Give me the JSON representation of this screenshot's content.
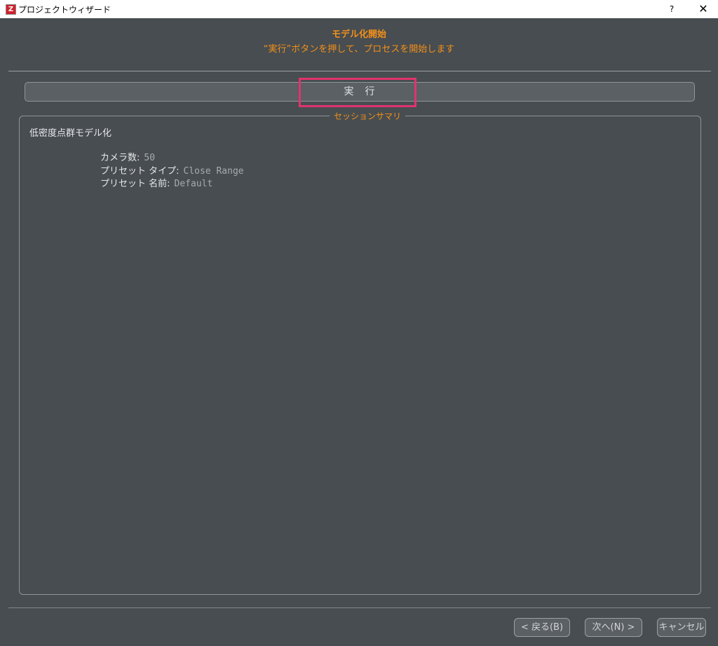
{
  "window": {
    "title": "プロジェクトウィザード",
    "app_icon_letter": "Z",
    "help_label": "?",
    "close_label": "✕"
  },
  "header": {
    "title": "モデル化開始",
    "subtitle": "“実行”ボタンを押して、プロセスを開始します"
  },
  "run_button": {
    "label": "実　行"
  },
  "summary": {
    "legend": "セッションサマリ",
    "heading": "低密度点群モデル化",
    "rows": [
      {
        "key": "カメラ数:",
        "value": "50"
      },
      {
        "key": "プリセット タイプ:",
        "value": "Close Range"
      },
      {
        "key": "プリセット 名前:",
        "value": "Default"
      }
    ]
  },
  "footer": {
    "back_label": "< 戻る(B)",
    "next_label": "次へ(N) >",
    "cancel_label": "キャンセル"
  },
  "colors": {
    "background": "#474d51",
    "accent_orange": "#f39019",
    "highlight_pink": "#e2336e"
  }
}
